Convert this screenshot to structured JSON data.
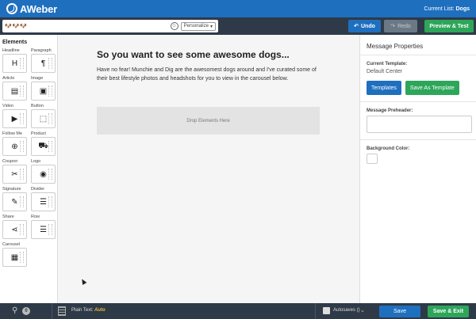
{
  "header": {
    "logo_text": "AWeber",
    "current_list_label": "Current List:",
    "current_list_value": "Dogs"
  },
  "toolbar": {
    "subject_value": "🐶🐶🐶",
    "emoji_icon": "smiley-icon",
    "personalize_label": "Personalize",
    "undo_label": "Undo",
    "redo_label": "Redo",
    "preview_label": "Preview & Test"
  },
  "elements_panel": {
    "title": "Elements",
    "items": [
      {
        "label": "Headline",
        "icon": "H"
      },
      {
        "label": "Paragraph",
        "icon": "¶"
      },
      {
        "label": "Article",
        "icon": "▤"
      },
      {
        "label": "Image",
        "icon": "▣"
      },
      {
        "label": "Video",
        "icon": "▶"
      },
      {
        "label": "Button",
        "icon": "⬚"
      },
      {
        "label": "Follow Me",
        "icon": "⊕"
      },
      {
        "label": "Product",
        "icon": "⛟"
      },
      {
        "label": "Coupon",
        "icon": "✂"
      },
      {
        "label": "Logo",
        "icon": "◉"
      },
      {
        "label": "Signature",
        "icon": "✎"
      },
      {
        "label": "Divider",
        "icon": "☰"
      },
      {
        "label": "Share",
        "icon": "⋖"
      },
      {
        "label": "Row",
        "icon": "☰"
      },
      {
        "label": "Carousel",
        "icon": "▦"
      }
    ]
  },
  "email": {
    "title": "So you want to see some awesome dogs...",
    "body": "Have no fear! Munchie and Dig are the awesomest dogs around and I've curated some of their best lifestyle photos and headshots for you to view in the carousel below.",
    "drop_zone": "Drop Elements Here"
  },
  "properties": {
    "title": "Message Properties",
    "current_template_label": "Current Template:",
    "current_template_value": "Default Center",
    "templates_button": "Templates",
    "save_template_button": "Save As Template",
    "preheader_label": "Message Preheader:",
    "preheader_value": "",
    "background_label": "Background Color:",
    "background_color": "#ffffff"
  },
  "footer": {
    "attachment_count": "0",
    "plain_text_label": "Plain Text:",
    "plain_text_value": "Auto",
    "autosave_label": "Autosaves ()",
    "save_label": "Save",
    "save_exit_label": "Save & Exit"
  },
  "colors": {
    "brand_blue": "#1f6fbf",
    "toolbar_dark": "#2e3a48",
    "success_green": "#2da65a"
  }
}
